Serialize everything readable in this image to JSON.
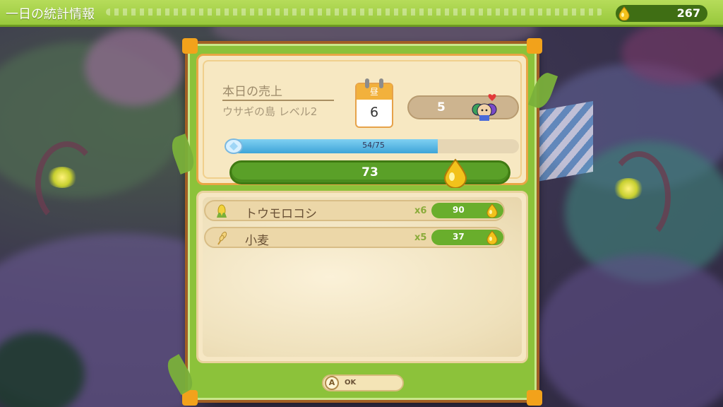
{
  "header": {
    "title": "一日の統計情報",
    "currency_icon": "golden-drop-icon",
    "currency_value": "267"
  },
  "summary": {
    "sales_title": "本日の売上",
    "island_level": "ウサギの島 レベル2",
    "calendar_label": "昼",
    "calendar_day": "6",
    "visitor_count": "5",
    "visitor_icon": "villagers-group-icon",
    "xp_label": "54/75",
    "xp_current": 54,
    "xp_max": 75,
    "xp_icon": "crystal-icon",
    "sales_total": "73"
  },
  "items": [
    {
      "name": "トウモロコシ",
      "icon": "corn-icon",
      "qty": "x6",
      "price": "90"
    },
    {
      "name": "小麦",
      "icon": "wheat-icon",
      "qty": "x5",
      "price": "37"
    }
  ],
  "footer": {
    "ok_button_glyph": "A",
    "ok_label": "OK"
  },
  "colors": {
    "accent_green": "#8cc23a",
    "frame_brown": "#a15f24",
    "xp_blue": "#3ea4d8",
    "drop_gold": "#f2c21b"
  }
}
